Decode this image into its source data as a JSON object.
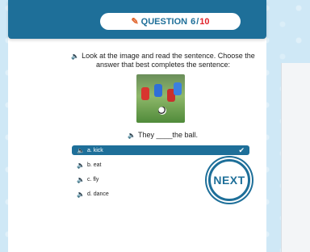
{
  "header": {
    "question_word": "QUESTION",
    "question_number": "6",
    "question_separator": "/",
    "question_total": "10"
  },
  "instruction": {
    "text": "Look at the image and read the sentence. Choose the answer that best completes the sentence:"
  },
  "sentence": {
    "text": "They ____the ball."
  },
  "options": [
    {
      "label": "a. kick",
      "selected": true
    },
    {
      "label": "b. eat",
      "selected": false
    },
    {
      "label": "c. fly",
      "selected": false
    },
    {
      "label": "d. dance",
      "selected": false
    }
  ],
  "next_button": {
    "label": "NEXT"
  },
  "colors": {
    "primary": "#1e6f99",
    "accent": "#e0232b",
    "background": "#cfe8f6"
  },
  "icons": {
    "audio": "speaker-icon",
    "edit": "edit-icon",
    "check": "check-icon"
  }
}
